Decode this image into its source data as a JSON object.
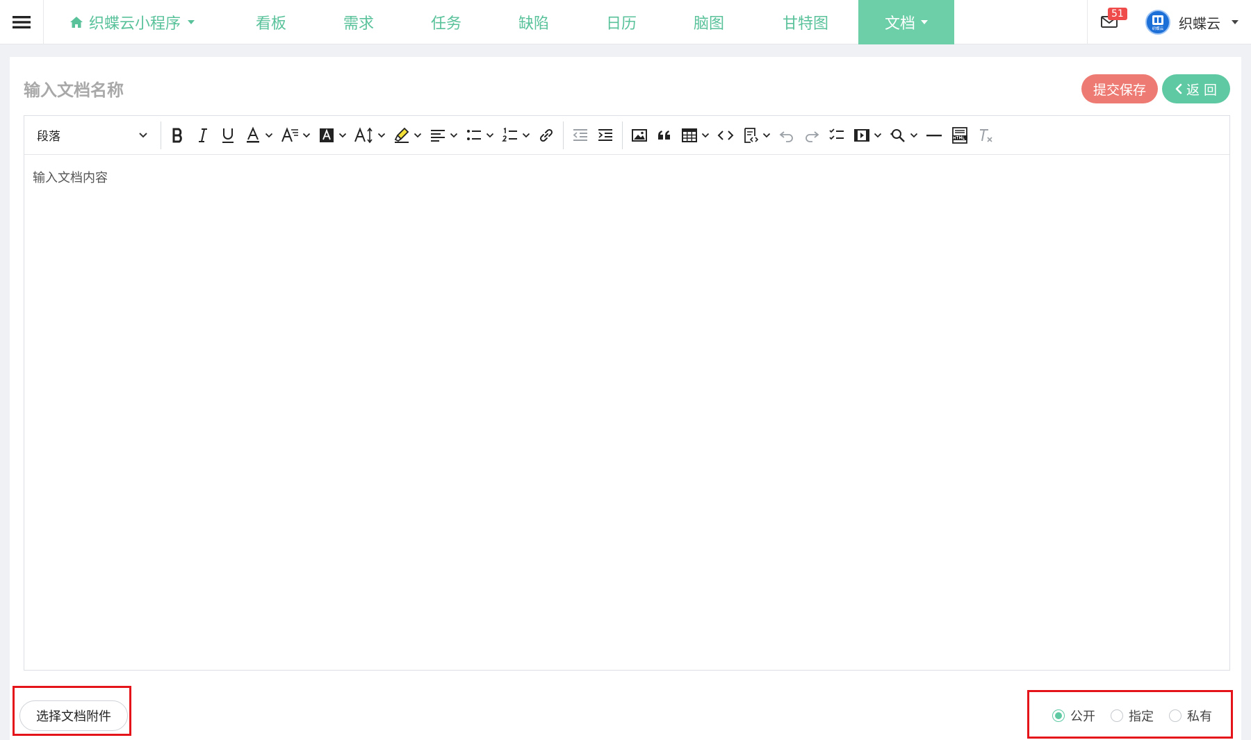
{
  "nav": {
    "project": "织蝶云小程序",
    "items": [
      {
        "label": "看板"
      },
      {
        "label": "需求"
      },
      {
        "label": "任务"
      },
      {
        "label": "缺陷"
      },
      {
        "label": "日历"
      },
      {
        "label": "脑图"
      },
      {
        "label": "甘特图"
      },
      {
        "label": "文档"
      }
    ],
    "mail_badge": "51",
    "user_name": "织蝶云",
    "avatar_text": "织蝶云"
  },
  "doc": {
    "title_placeholder": "输入文档名称",
    "save_label": "提交保存",
    "back_label": "返 回",
    "content_placeholder": "输入文档内容"
  },
  "toolbar": {
    "heading": "段落"
  },
  "footer": {
    "attach_label": "选择文档附件",
    "visibility": [
      {
        "label": "公开",
        "checked": true
      },
      {
        "label": "指定",
        "checked": false
      },
      {
        "label": "私有",
        "checked": false
      }
    ]
  },
  "colors": {
    "accent": "#59c29b",
    "active_tab": "#6ccfa8",
    "save": "#ee7b73",
    "back": "#5ec9a2",
    "highlight_box": "#e5141b",
    "badge": "#ef4b4b"
  }
}
